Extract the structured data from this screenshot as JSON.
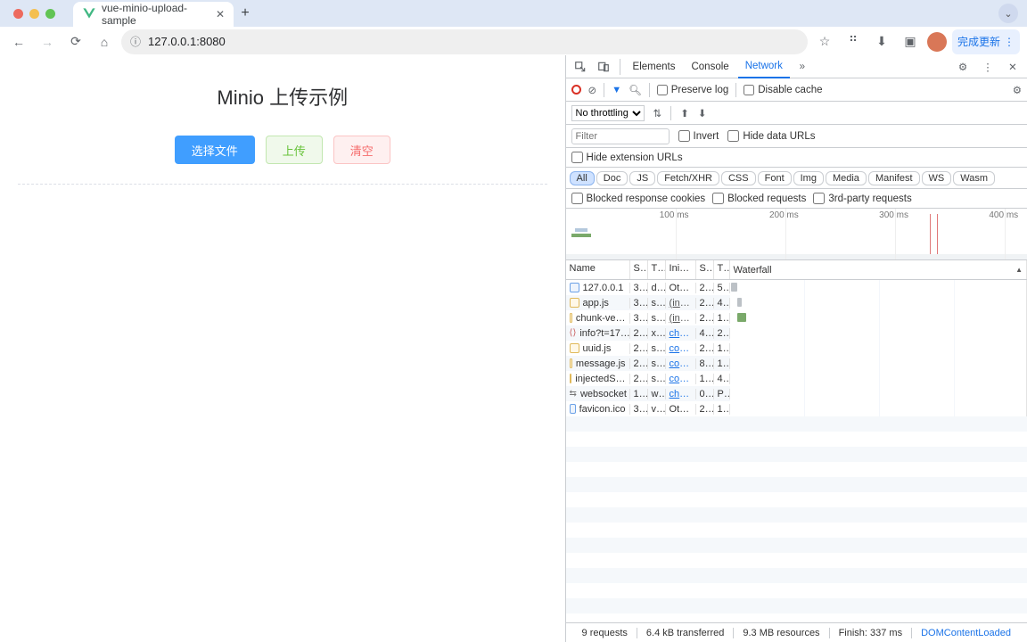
{
  "browser": {
    "tab_title": "vue-minio-upload-sample",
    "url": "127.0.0.1:8080",
    "update_button": "完成更新"
  },
  "page": {
    "title": "Minio 上传示例",
    "buttons": {
      "choose": "选择文件",
      "upload": "上传",
      "clear": "清空"
    }
  },
  "devtools": {
    "tabs": {
      "elements": "Elements",
      "console": "Console",
      "network": "Network"
    },
    "toolbar": {
      "preserve_log": "Preserve log",
      "disable_cache": "Disable cache",
      "throttling": "No throttling",
      "filter_placeholder": "Filter",
      "invert": "Invert",
      "hide_data_urls": "Hide data URLs",
      "hide_ext_urls": "Hide extension URLs",
      "blocked_cookies": "Blocked response cookies",
      "blocked_requests": "Blocked requests",
      "third_party": "3rd-party requests"
    },
    "chips": [
      "All",
      "Doc",
      "JS",
      "Fetch/XHR",
      "CSS",
      "Font",
      "Img",
      "Media",
      "Manifest",
      "WS",
      "Wasm"
    ],
    "overview": {
      "ticks": [
        "100 ms",
        "200 ms",
        "300 ms",
        "400 ms"
      ]
    },
    "columns": {
      "name": "Name",
      "status": "S…",
      "type": "T…",
      "initiator": "Initia…",
      "size": "S…",
      "time": "T…",
      "waterfall": "Waterfall"
    },
    "requests": [
      {
        "name": "127.0.0.1",
        "status": "3…",
        "type": "d…",
        "initiator": "Other",
        "size": "2…",
        "time": "5…",
        "icon": "doc",
        "wf": {
          "l": 1,
          "w": 7,
          "c": "grey"
        }
      },
      {
        "name": "app.js",
        "status": "3…",
        "type": "s…",
        "initiator": "(inde…",
        "size": "2…",
        "time": "4…",
        "icon": "js",
        "wf": {
          "l": 8,
          "w": 5,
          "c": "grey"
        }
      },
      {
        "name": "chunk-ve…",
        "status": "3…",
        "type": "s…",
        "initiator": "(inde…",
        "size": "2…",
        "time": "1…",
        "icon": "js",
        "wf": {
          "l": 8,
          "w": 10,
          "c": "green"
        }
      },
      {
        "name": "info?t=17…",
        "status": "2…",
        "type": "xhr",
        "initiator": "chun…",
        "size": "4…",
        "time": "2…",
        "icon": "xhr",
        "wf": {
          "l": 0,
          "w": 0,
          "c": "grey"
        }
      },
      {
        "name": "uuid.js",
        "status": "2…",
        "type": "s…",
        "initiator": "cont…",
        "size": "2…",
        "time": "1…",
        "icon": "js",
        "wf": {
          "l": 0,
          "w": 0,
          "c": "grey"
        }
      },
      {
        "name": "message.js",
        "status": "2…",
        "type": "s…",
        "initiator": "cont…",
        "size": "8…",
        "time": "1…",
        "icon": "js",
        "wf": {
          "l": 0,
          "w": 0,
          "c": "grey"
        }
      },
      {
        "name": "injectedS…",
        "status": "2…",
        "type": "s…",
        "initiator": "cont…",
        "size": "1…",
        "time": "4…",
        "icon": "js",
        "wf": {
          "l": 0,
          "w": 0,
          "c": "grey"
        }
      },
      {
        "name": "websocket",
        "status": "1…",
        "type": "w…",
        "initiator": "chun…",
        "size": "0 B",
        "time": "P…",
        "icon": "ws",
        "wf": {
          "l": 0,
          "w": 0,
          "c": "grey"
        }
      },
      {
        "name": "favicon.ico",
        "status": "3…",
        "type": "v…",
        "initiator": "Other",
        "size": "2…",
        "time": "1…",
        "icon": "doc",
        "wf": {
          "l": 0,
          "w": 0,
          "c": "grey"
        }
      }
    ],
    "status": {
      "requests": "9 requests",
      "transferred": "6.4 kB transferred",
      "resources": "9.3 MB resources",
      "finish": "Finish: 337 ms",
      "domcontent": "DOMContentLoaded"
    }
  }
}
